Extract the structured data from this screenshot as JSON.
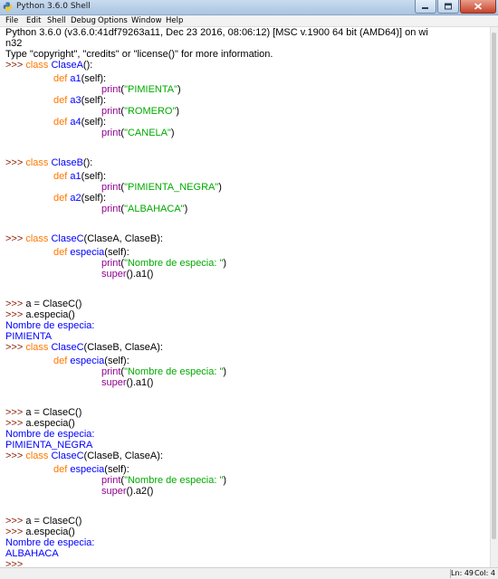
{
  "window": {
    "title": "Python 3.6.0 Shell",
    "controls": [
      "minimize-icon",
      "maximize-icon",
      "close-icon"
    ]
  },
  "menu": [
    "File",
    "Edit",
    "Shell",
    "Debug",
    "Options",
    "Window",
    "Help"
  ],
  "colors": {
    "keyword": "#ff7700",
    "builtin": "#900090",
    "string": "#00aa00",
    "definition": "#0000ff",
    "prompt": "#8b1a00",
    "stdout": "#0000ff",
    "text": "#000000"
  },
  "shell": {
    "lines": [
      [
        {
          "t": "Python 3.6.0 (v3.6.0:41df79263a11, Dec 23 2016, 08:06:12) [MSC v.1900 64 bit (AMD64)] on wi",
          "c": "normal"
        }
      ],
      [
        {
          "t": "n32",
          "c": "normal"
        }
      ],
      [
        {
          "t": "Type \"copyright\", \"credits\" or \"license()\" for more information.",
          "c": "normal"
        }
      ],
      [
        {
          "t": ">>> ",
          "c": "prompt"
        },
        {
          "t": "class ",
          "c": "keyword"
        },
        {
          "t": "ClaseA",
          "c": "defname"
        },
        {
          "t": "():",
          "c": "normal"
        }
      ],
      [
        {
          "t": "\t",
          "c": "normal"
        },
        {
          "t": "def ",
          "c": "keyword"
        },
        {
          "t": "a1",
          "c": "defname"
        },
        {
          "t": "(self):",
          "c": "normal"
        }
      ],
      [
        {
          "t": "\t\t",
          "c": "normal"
        },
        {
          "t": "print",
          "c": "builtin"
        },
        {
          "t": "(",
          "c": "normal"
        },
        {
          "t": "\"PIMIENTA\"",
          "c": "string"
        },
        {
          "t": ")",
          "c": "normal"
        }
      ],
      [
        {
          "t": "\t",
          "c": "normal"
        },
        {
          "t": "def ",
          "c": "keyword"
        },
        {
          "t": "a3",
          "c": "defname"
        },
        {
          "t": "(self):",
          "c": "normal"
        }
      ],
      [
        {
          "t": "\t\t",
          "c": "normal"
        },
        {
          "t": "print",
          "c": "builtin"
        },
        {
          "t": "(",
          "c": "normal"
        },
        {
          "t": "\"ROMERO\"",
          "c": "string"
        },
        {
          "t": ")",
          "c": "normal"
        }
      ],
      [
        {
          "t": "\t",
          "c": "normal"
        },
        {
          "t": "def ",
          "c": "keyword"
        },
        {
          "t": "a4",
          "c": "defname"
        },
        {
          "t": "(self):",
          "c": "normal"
        }
      ],
      [
        {
          "t": "\t\t",
          "c": "normal"
        },
        {
          "t": "print",
          "c": "builtin"
        },
        {
          "t": "(",
          "c": "normal"
        },
        {
          "t": "\"CANELA\"",
          "c": "string"
        },
        {
          "t": ")",
          "c": "normal"
        }
      ],
      [],
      [],
      [
        {
          "t": ">>> ",
          "c": "prompt"
        },
        {
          "t": "class ",
          "c": "keyword"
        },
        {
          "t": "ClaseB",
          "c": "defname"
        },
        {
          "t": "():",
          "c": "normal"
        }
      ],
      [
        {
          "t": "\t",
          "c": "normal"
        },
        {
          "t": "def ",
          "c": "keyword"
        },
        {
          "t": "a1",
          "c": "defname"
        },
        {
          "t": "(self):",
          "c": "normal"
        }
      ],
      [
        {
          "t": "\t\t",
          "c": "normal"
        },
        {
          "t": "print",
          "c": "builtin"
        },
        {
          "t": "(",
          "c": "normal"
        },
        {
          "t": "\"PIMIENTA_NEGRA\"",
          "c": "string"
        },
        {
          "t": ")",
          "c": "normal"
        }
      ],
      [
        {
          "t": "\t",
          "c": "normal"
        },
        {
          "t": "def ",
          "c": "keyword"
        },
        {
          "t": "a2",
          "c": "defname"
        },
        {
          "t": "(self):",
          "c": "normal"
        }
      ],
      [
        {
          "t": "\t\t",
          "c": "normal"
        },
        {
          "t": "print",
          "c": "builtin"
        },
        {
          "t": "(",
          "c": "normal"
        },
        {
          "t": "\"ALBAHACA\"",
          "c": "string"
        },
        {
          "t": ")",
          "c": "normal"
        }
      ],
      [],
      [],
      [
        {
          "t": ">>> ",
          "c": "prompt"
        },
        {
          "t": "class ",
          "c": "keyword"
        },
        {
          "t": "ClaseC",
          "c": "defname"
        },
        {
          "t": "(ClaseA, ClaseB):",
          "c": "normal"
        }
      ],
      [
        {
          "t": "\t",
          "c": "normal"
        },
        {
          "t": "def ",
          "c": "keyword"
        },
        {
          "t": "especia",
          "c": "defname"
        },
        {
          "t": "(self):",
          "c": "normal"
        }
      ],
      [
        {
          "t": "\t\t",
          "c": "normal"
        },
        {
          "t": "print",
          "c": "builtin"
        },
        {
          "t": "(",
          "c": "normal"
        },
        {
          "t": "\"Nombre de especia: \"",
          "c": "string"
        },
        {
          "t": ")",
          "c": "normal"
        }
      ],
      [
        {
          "t": "\t\t",
          "c": "normal"
        },
        {
          "t": "super",
          "c": "builtin"
        },
        {
          "t": "().a1()",
          "c": "normal"
        }
      ],
      [],
      [],
      [
        {
          "t": ">>> ",
          "c": "prompt"
        },
        {
          "t": "a = ClaseC()",
          "c": "normal"
        }
      ],
      [
        {
          "t": ">>> ",
          "c": "prompt"
        },
        {
          "t": "a.especia()",
          "c": "normal"
        }
      ],
      [
        {
          "t": "Nombre de especia:",
          "c": "stdout"
        }
      ],
      [
        {
          "t": "PIMIENTA",
          "c": "stdout"
        }
      ],
      [
        {
          "t": ">>> ",
          "c": "prompt"
        },
        {
          "t": "class ",
          "c": "keyword"
        },
        {
          "t": "ClaseC",
          "c": "defname"
        },
        {
          "t": "(ClaseB, ClaseA):",
          "c": "normal"
        }
      ],
      [
        {
          "t": "\t",
          "c": "normal"
        },
        {
          "t": "def ",
          "c": "keyword"
        },
        {
          "t": "especia",
          "c": "defname"
        },
        {
          "t": "(self):",
          "c": "normal"
        }
      ],
      [
        {
          "t": "\t\t",
          "c": "normal"
        },
        {
          "t": "print",
          "c": "builtin"
        },
        {
          "t": "(",
          "c": "normal"
        },
        {
          "t": "\"Nombre de especia: \"",
          "c": "string"
        },
        {
          "t": ")",
          "c": "normal"
        }
      ],
      [
        {
          "t": "\t\t",
          "c": "normal"
        },
        {
          "t": "super",
          "c": "builtin"
        },
        {
          "t": "().a1()",
          "c": "normal"
        }
      ],
      [],
      [],
      [
        {
          "t": ">>> ",
          "c": "prompt"
        },
        {
          "t": "a = ClaseC()",
          "c": "normal"
        }
      ],
      [
        {
          "t": ">>> ",
          "c": "prompt"
        },
        {
          "t": "a.especia()",
          "c": "normal"
        }
      ],
      [
        {
          "t": "Nombre de especia:",
          "c": "stdout"
        }
      ],
      [
        {
          "t": "PIMIENTA_NEGRA",
          "c": "stdout"
        }
      ],
      [
        {
          "t": ">>> ",
          "c": "prompt"
        },
        {
          "t": "class ",
          "c": "keyword"
        },
        {
          "t": "ClaseC",
          "c": "defname"
        },
        {
          "t": "(ClaseB, ClaseA):",
          "c": "normal"
        }
      ],
      [
        {
          "t": "\t",
          "c": "normal"
        },
        {
          "t": "def ",
          "c": "keyword"
        },
        {
          "t": "especia",
          "c": "defname"
        },
        {
          "t": "(self):",
          "c": "normal"
        }
      ],
      [
        {
          "t": "\t\t",
          "c": "normal"
        },
        {
          "t": "print",
          "c": "builtin"
        },
        {
          "t": "(",
          "c": "normal"
        },
        {
          "t": "\"Nombre de especia: \"",
          "c": "string"
        },
        {
          "t": ")",
          "c": "normal"
        }
      ],
      [
        {
          "t": "\t\t",
          "c": "normal"
        },
        {
          "t": "super",
          "c": "builtin"
        },
        {
          "t": "().a2()",
          "c": "normal"
        }
      ],
      [],
      [],
      [
        {
          "t": ">>> ",
          "c": "prompt"
        },
        {
          "t": "a = ClaseC()",
          "c": "normal"
        }
      ],
      [
        {
          "t": ">>> ",
          "c": "prompt"
        },
        {
          "t": "a.especia()",
          "c": "normal"
        }
      ],
      [
        {
          "t": "Nombre de especia:",
          "c": "stdout"
        }
      ],
      [
        {
          "t": "ALBAHACA",
          "c": "stdout"
        }
      ],
      [
        {
          "t": ">>> ",
          "c": "prompt"
        }
      ]
    ]
  },
  "status": {
    "line": "Ln: 49",
    "col": "Col: 4"
  }
}
